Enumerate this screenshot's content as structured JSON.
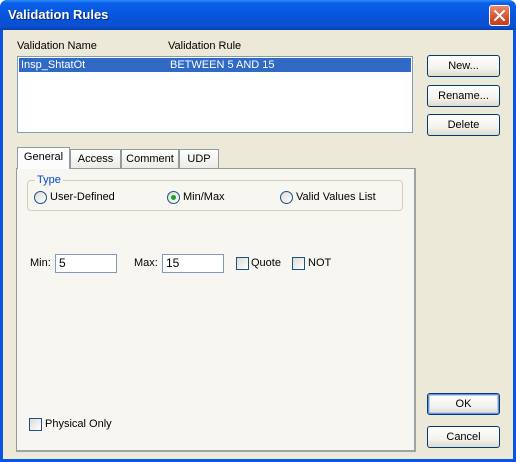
{
  "window": {
    "title": "Validation Rules"
  },
  "list": {
    "headers": [
      "Validation Name",
      "Validation Rule"
    ],
    "rows": [
      {
        "name": "Insp_ShtatOt",
        "rule": "BETWEEN 5 AND 15",
        "selected": true
      }
    ]
  },
  "buttons": {
    "new": "New...",
    "rename": "Rename...",
    "delete": "Delete",
    "ok": "OK",
    "cancel": "Cancel"
  },
  "tabs": [
    {
      "label": "General",
      "active": true
    },
    {
      "label": "Access",
      "active": false
    },
    {
      "label": "Comment",
      "active": false
    },
    {
      "label": "UDP",
      "active": false
    }
  ],
  "general": {
    "type_legend": "Type",
    "type_options": [
      {
        "label": "User-Defined",
        "selected": false
      },
      {
        "label": "Min/Max",
        "selected": true
      },
      {
        "label": "Valid Values List",
        "selected": false
      }
    ],
    "min_label": "Min:",
    "min_value": "5",
    "max_label": "Max:",
    "max_value": "15",
    "quote_label": "Quote",
    "quote_checked": false,
    "not_label": "NOT",
    "not_checked": false,
    "physical_only_label": "Physical Only",
    "physical_only_checked": false
  },
  "colors": {
    "titlebar": "#0a54e2",
    "selection": "#316ac5",
    "face": "#ece9d8",
    "close": "#d5522e"
  }
}
